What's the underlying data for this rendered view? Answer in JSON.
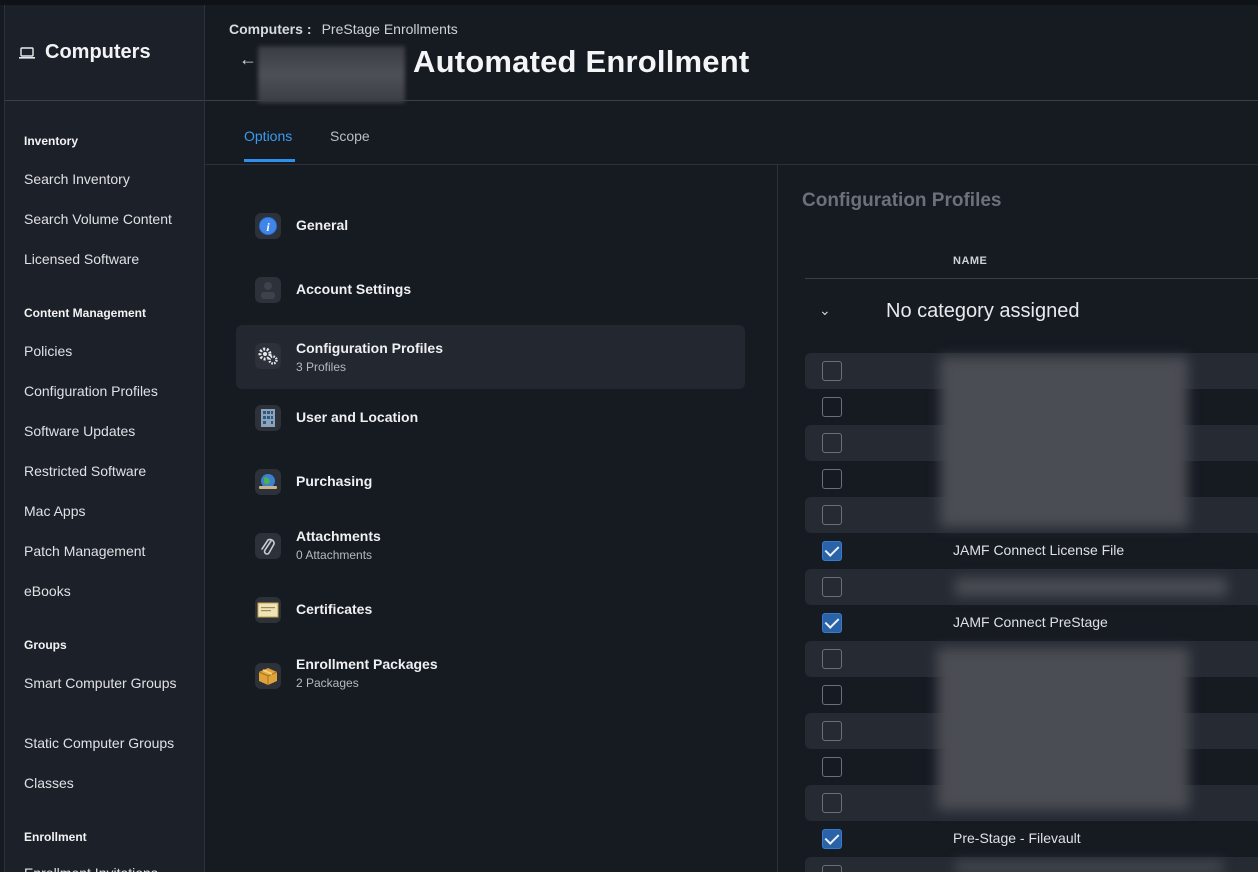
{
  "sidebar": {
    "title": "Computers",
    "sections": [
      {
        "label": "Inventory",
        "items": [
          "Search Inventory",
          "Search Volume Content",
          "Licensed Software"
        ]
      },
      {
        "label": "Content Management",
        "items": [
          "Policies",
          "Configuration Profiles",
          "Software Updates",
          "Restricted Software",
          "Mac Apps",
          "Patch Management",
          "eBooks"
        ]
      },
      {
        "label": "Groups",
        "items": [
          "Smart Computer Groups",
          "Static Computer Groups",
          "Classes"
        ]
      },
      {
        "label": "Enrollment",
        "items": [
          "Enrollment Invitations"
        ]
      }
    ]
  },
  "header": {
    "breadcrumb_root": "Computers",
    "breadcrumb_sep": ":",
    "breadcrumb_current": "PreStage Enrollments",
    "back_icon": "←",
    "title": "Automated Enrollment"
  },
  "tabs": [
    {
      "label": "Options",
      "active": true
    },
    {
      "label": "Scope",
      "active": false
    }
  ],
  "options": [
    {
      "label": "General",
      "sub": "",
      "icon": "info-icon",
      "selected": false
    },
    {
      "label": "Account Settings",
      "sub": "",
      "icon": "user-icon",
      "selected": false
    },
    {
      "label": "Configuration Profiles",
      "sub": "3 Profiles",
      "icon": "gears-icon",
      "selected": true
    },
    {
      "label": "User and Location",
      "sub": "",
      "icon": "building-icon",
      "selected": false
    },
    {
      "label": "Purchasing",
      "sub": "",
      "icon": "globe-icon",
      "selected": false
    },
    {
      "label": "Attachments",
      "sub": "0 Attachments",
      "icon": "paperclip-icon",
      "selected": false
    },
    {
      "label": "Certificates",
      "sub": "",
      "icon": "certificate-icon",
      "selected": false
    },
    {
      "label": "Enrollment Packages",
      "sub": "2 Packages",
      "icon": "package-icon",
      "selected": false
    }
  ],
  "profiles_panel": {
    "title": "Configuration Profiles",
    "column_header": "NAME",
    "category": "No category assigned",
    "chevron": "⌄",
    "rows": [
      {
        "name": "",
        "checked": false
      },
      {
        "name": "",
        "checked": false
      },
      {
        "name": "",
        "checked": false
      },
      {
        "name": "",
        "checked": false
      },
      {
        "name": "",
        "checked": false
      },
      {
        "name": "JAMF Connect License File",
        "checked": true
      },
      {
        "name": "",
        "checked": false
      },
      {
        "name": "JAMF Connect PreStage",
        "checked": true
      },
      {
        "name": "",
        "checked": false
      },
      {
        "name": "",
        "checked": false
      },
      {
        "name": "",
        "checked": false
      },
      {
        "name": "",
        "checked": false
      },
      {
        "name": "",
        "checked": false
      },
      {
        "name": "Pre-Stage - Filevault",
        "checked": true
      },
      {
        "name": "",
        "checked": false
      }
    ]
  },
  "colors": {
    "accent": "#2f8fec",
    "checkbox_on": "#2a62a8",
    "background": "#161a21",
    "sidebar": "#1c2028"
  }
}
